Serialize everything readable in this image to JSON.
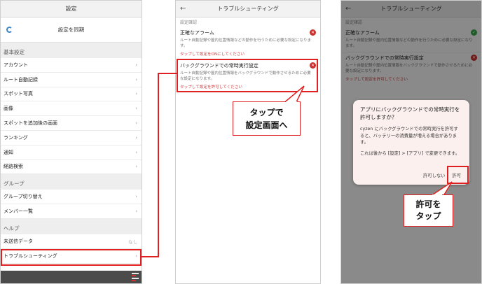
{
  "settings_screen": {
    "title": "設定",
    "sync_label": "設定を同期",
    "sections": [
      {
        "header": "基本設定",
        "items": [
          "アカウント",
          "ルート自動記録",
          "スポット写真",
          "画像",
          "スポットを追加後の画面",
          "ランキング",
          "通知",
          "経路検索"
        ]
      },
      {
        "header": "グループ",
        "items": [
          "グループ切り替え",
          "メンバー一覧"
        ]
      },
      {
        "header": "ヘルプ",
        "items": [
          "未送信データ",
          "トラブルシューティング"
        ]
      }
    ],
    "unsent_value": "なし",
    "chevron": "›"
  },
  "trouble_screen": {
    "title": "トラブルシューティング",
    "back": "←",
    "section_label": "設定確認",
    "items": [
      {
        "title": "正確なアラーム",
        "desc": "ルート自動記録や屋内位置情報などの動作を行うために必要な設定になります。",
        "link": "タップして設定をONにしてください",
        "status": "error"
      },
      {
        "title": "バックグラウンドでの常時実行設定",
        "desc": "ルート自動記録や屋内位置情報をバックグラウンドで動作させるために必要な設定になります。",
        "link": "タップして設定を許可してください",
        "status": "error"
      }
    ],
    "callout": {
      "line1": "タップで",
      "line2": "設定画面へ"
    }
  },
  "dialog_screen": {
    "title": "トラブルシューティング",
    "back": "←",
    "section_label": "設定確認",
    "items": [
      {
        "title": "正確なアラーム",
        "desc": "ルート自動記録や屋内位置情報などの動作を行うために必要な設定になります。",
        "status": "ok"
      },
      {
        "title": "バックグラウンドでの常時実行設定",
        "desc": "ルート自動記録や屋内位置情報をバックグラウンドで動作させるために必要な設定になります。",
        "link": "タップして設定を許可してください",
        "status": "error"
      }
    ],
    "dialog": {
      "title": "アプリにバックグラウンドでの常時実行を許可しますか？",
      "body1": "cyzen にバックグラウンドでの常時実行を許可すると、バッテリーの消費量が増える場合があります。",
      "body2": "これは後から [設定] > [アプリ] で変更できます。",
      "deny": "許可しない",
      "allow": "許可"
    },
    "callout": {
      "line1": "許可を",
      "line2": "タップ"
    }
  },
  "icons": {
    "error": "x-circle-icon",
    "ok": "check-circle-icon",
    "sync": "sync-icon"
  },
  "colors": {
    "accent_red": "#e02020",
    "error_red": "#c8322e",
    "ok_green": "#3aa84a",
    "sync_blue": "#3a86c8"
  }
}
